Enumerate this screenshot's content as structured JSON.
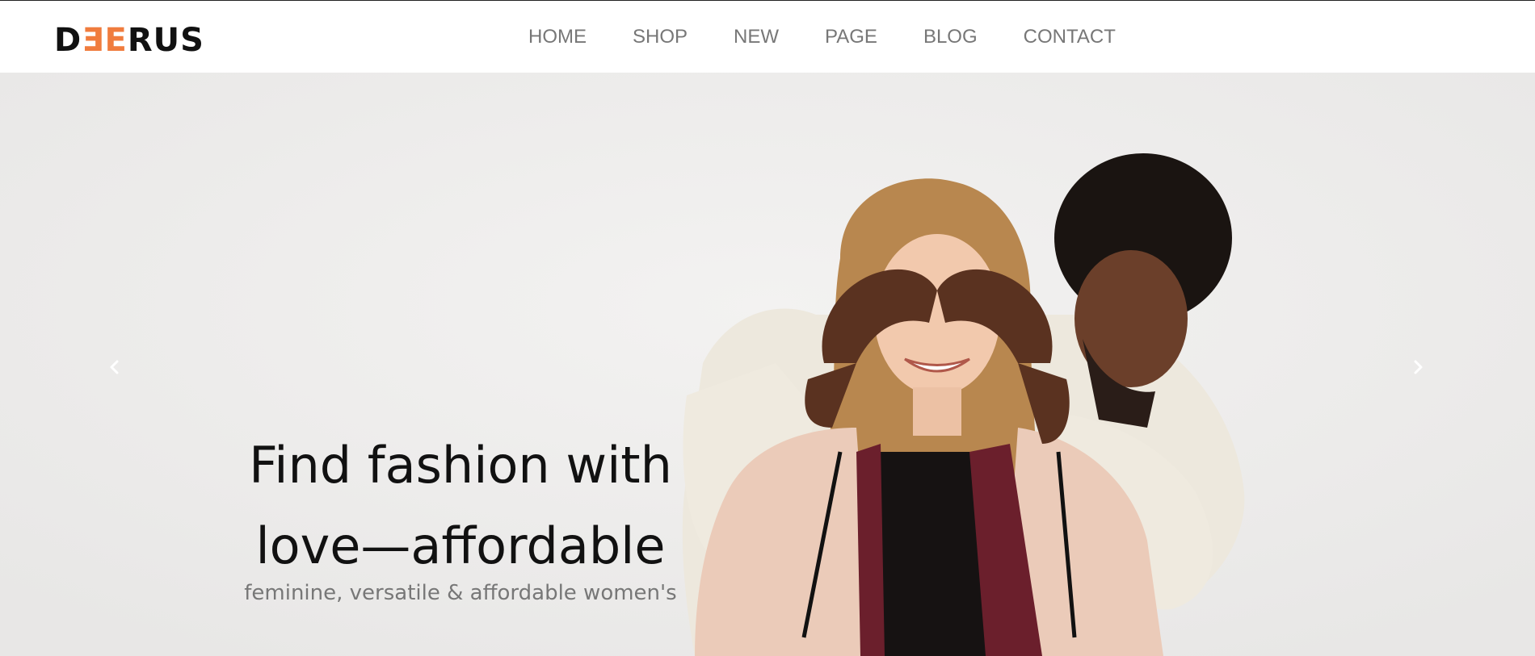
{
  "header": {
    "logo": {
      "part1": "D",
      "part2": "E",
      "part3": "E",
      "part4": "RUS",
      "accent_color": "#f07c3e"
    },
    "nav": [
      {
        "label": "HOME"
      },
      {
        "label": "SHOP"
      },
      {
        "label": "NEW"
      },
      {
        "label": "PAGE"
      },
      {
        "label": "BLOG"
      },
      {
        "label": "CONTACT"
      }
    ]
  },
  "hero": {
    "headline_line1": "Find fashion with",
    "headline_line2": "love—affordable",
    "subline": "feminine, versatile & affordable women's",
    "prev_icon": "chevron-left-icon",
    "next_icon": "chevron-right-icon",
    "image": "couple-in-fleece-jackets-photo"
  }
}
